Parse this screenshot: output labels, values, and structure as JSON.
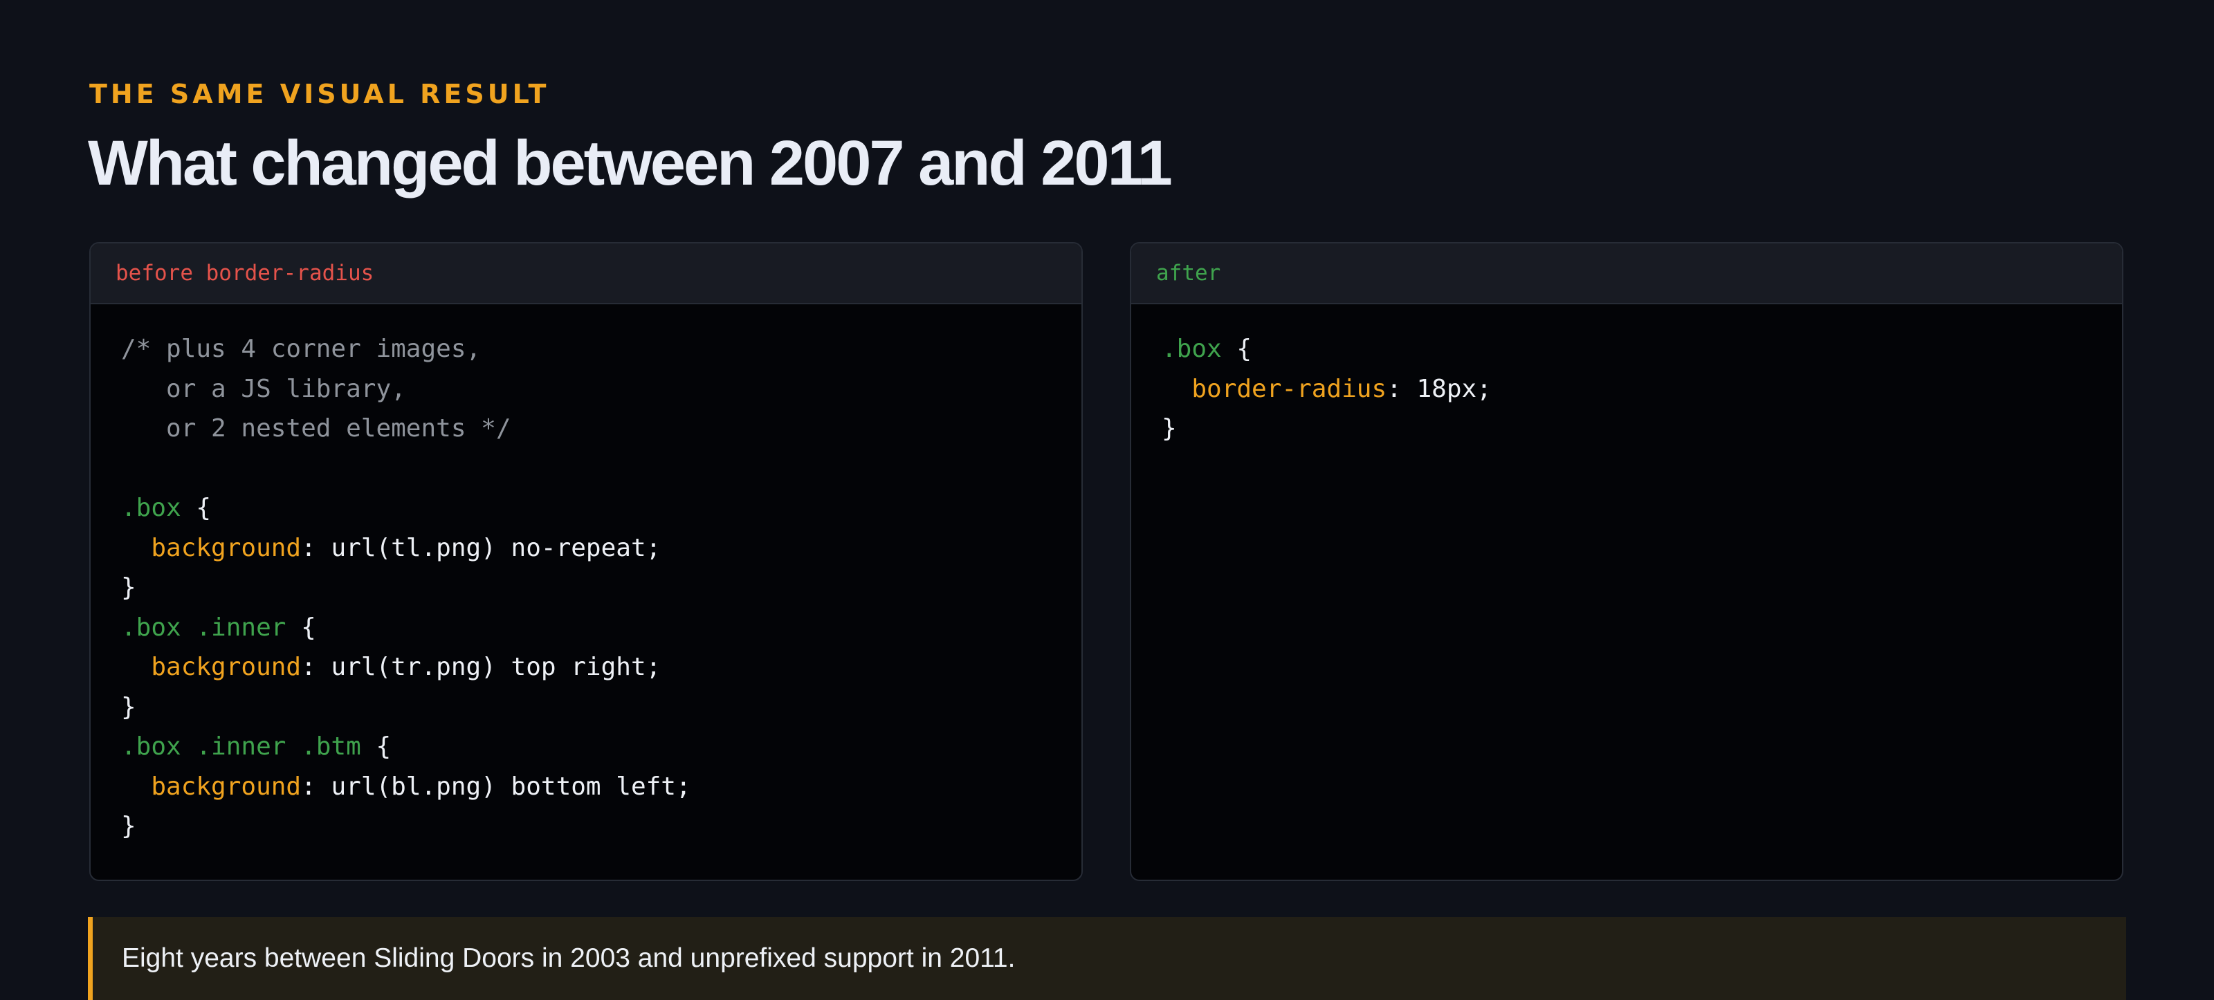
{
  "header": {
    "eyebrow": "THE SAME VISUAL RESULT",
    "title": "What changed between 2007 and 2011"
  },
  "before_panel": {
    "label": "before border-radius",
    "comment": [
      "/* plus 4 corner images,",
      "   or a JS library,",
      "   or 2 nested elements */"
    ],
    "rules": [
      {
        "selector": ".box",
        "property": "background",
        "value": "url(tl.png) no-repeat;"
      },
      {
        "selector": ".box .inner",
        "property": "background",
        "value": "url(tr.png) top right;"
      },
      {
        "selector": ".box .inner .btm",
        "property": "background",
        "value": "url(bl.png) bottom left;"
      }
    ]
  },
  "after_panel": {
    "label": "after",
    "rules": [
      {
        "selector": ".box",
        "property": "border-radius",
        "value": "18px;"
      }
    ]
  },
  "note": {
    "text": "Eight years between Sliding Doors in 2003 and unprefixed support in 2011."
  },
  "colors": {
    "background": "#0e1119",
    "accent": "#f0a31f",
    "selector": "#3fa34d",
    "before_label": "#e5534b",
    "comment": "#8f949c"
  }
}
